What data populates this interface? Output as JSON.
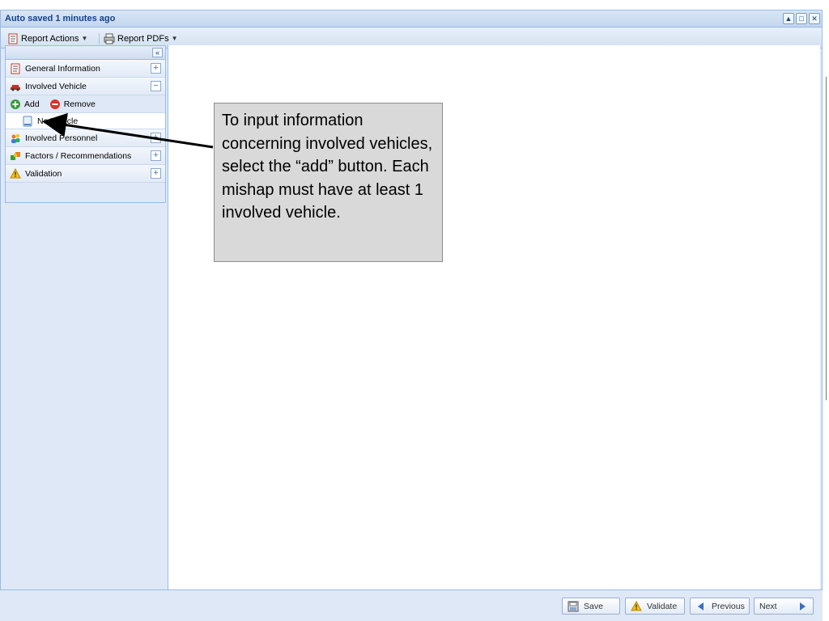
{
  "window": {
    "title": "Auto saved 1 minutes ago",
    "tools": [
      "collapse-icon",
      "maximize-icon",
      "close-icon"
    ]
  },
  "toolbar": {
    "report_actions_label": "Report Actions",
    "report_pdfs_label": "Report PDFs"
  },
  "sidebar": {
    "items": [
      {
        "label": "General Information",
        "icon": "report-icon",
        "toggle": "+"
      },
      {
        "label": "Involved Vehicle",
        "icon": "car-icon",
        "toggle": "−"
      },
      {
        "label": "Involved Personnel",
        "icon": "people-icon",
        "toggle": "+"
      },
      {
        "label": "Factors / Recommendations",
        "icon": "puzzle-icon",
        "toggle": "+"
      },
      {
        "label": "Validation",
        "icon": "warning-icon",
        "toggle": "+"
      }
    ],
    "vehicle_actions": {
      "add_label": "Add",
      "remove_label": "Remove"
    },
    "vehicle_leaf_label": "No Vehicle"
  },
  "callout": {
    "text": "To input information concerning involved vehicles, select the “add” button.  Each mishap must have at least 1 involved vehicle."
  },
  "bottom_buttons": {
    "save_label": "Save",
    "validate_label": "Validate",
    "previous_label": "Previous",
    "next_label": "Next"
  },
  "colors": {
    "accent": "#15428b",
    "panel": "#dfe8f6",
    "border": "#99bbe8",
    "callout_bg": "#d9d9d9"
  }
}
